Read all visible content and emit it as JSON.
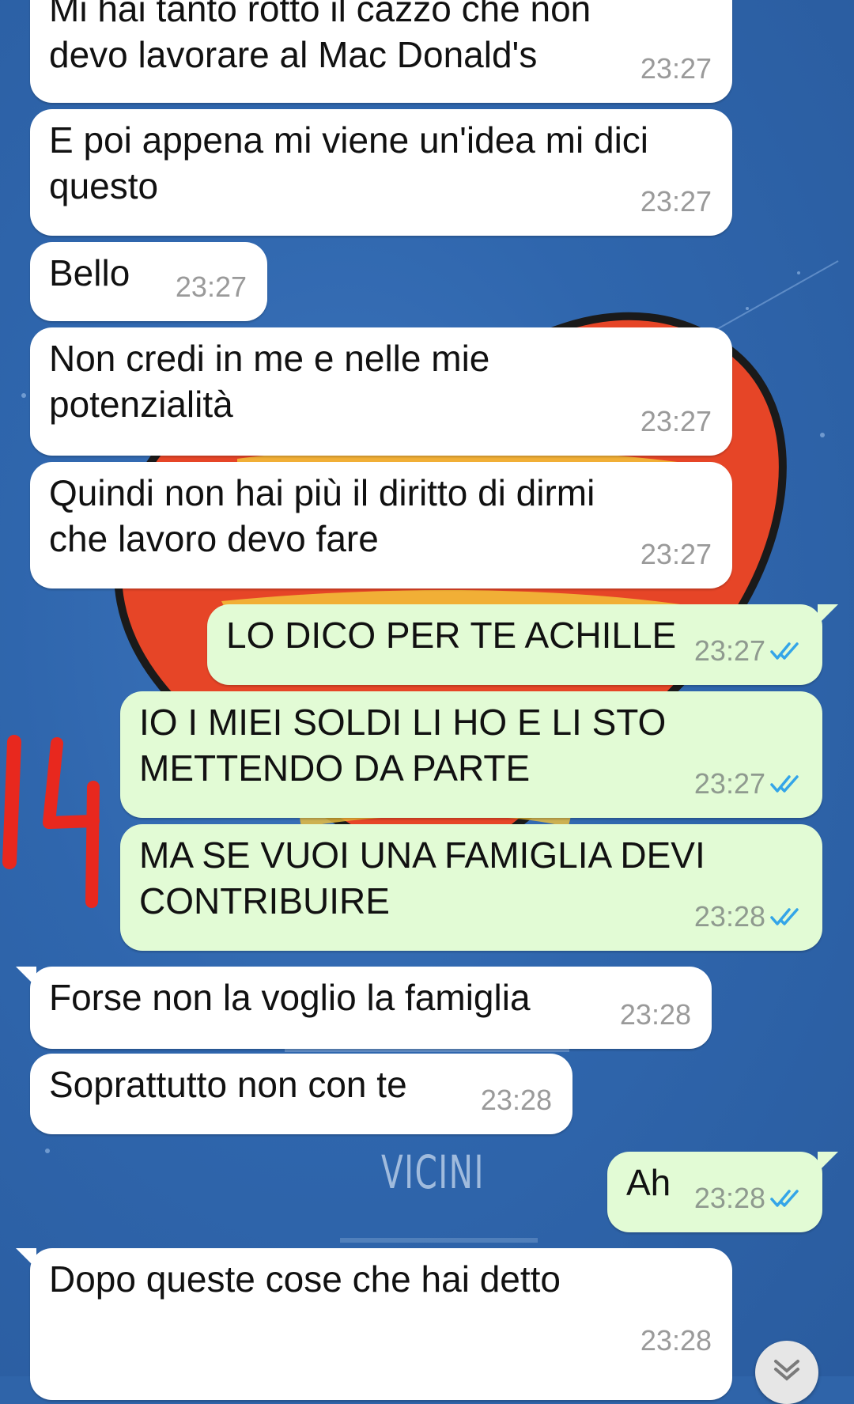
{
  "messages": [
    {
      "text": "Mi hai tanto rotto il cazzo che non\ndevo lavorare al Mac Donald's",
      "time": "23:27"
    },
    {
      "text": "E poi appena mi viene un'idea mi dici\nquesto",
      "time": "23:27"
    },
    {
      "text": "Bello",
      "time": "23:27"
    },
    {
      "text": "Non credi in me e nelle mie\npotenzialità",
      "time": "23:27"
    },
    {
      "text": "Quindi non hai più il diritto di dirmi\nche lavoro devo fare",
      "time": "23:27"
    },
    {
      "text": "LO DICO PER TE ACHILLE",
      "time": "23:27"
    },
    {
      "text": "IO I MIEI SOLDI LI HO E LI STO\nMETTENDO DA PARTE",
      "time": "23:27"
    },
    {
      "text": "MA SE VUOI UNA FAMIGLIA DEVI\nCONTRIBUIRE",
      "time": "23:28"
    },
    {
      "text": "Forse non la voglio la famiglia",
      "time": "23:28"
    },
    {
      "text": "Soprattutto non con te",
      "time": "23:28"
    },
    {
      "text": "Ah",
      "time": "23:28"
    },
    {
      "text": "Dopo queste cose che hai detto",
      "time": "23:28"
    }
  ],
  "annotation_text": "14",
  "wallpaper_text": "VICINI",
  "colors": {
    "background": "#2f64a9",
    "incoming_bubble": "#ffffff",
    "outgoing_bubble": "#e2fbd5",
    "read_ticks": "#34a5e8",
    "annotation": "#e8281e",
    "heart": "#e64527"
  },
  "icons": {
    "read_status": "double-check-icon",
    "scroll_down": "chevron-down-icon"
  }
}
